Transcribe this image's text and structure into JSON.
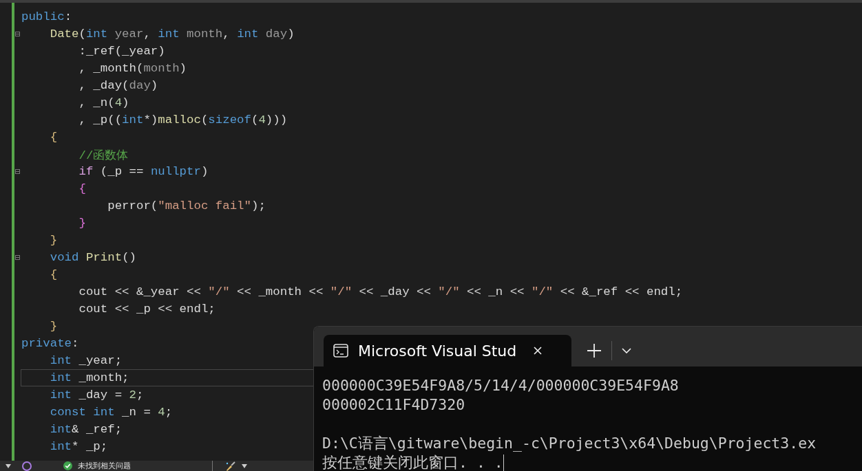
{
  "editor": {
    "lines": [
      {
        "fold": false,
        "current": false,
        "tokens": [
          {
            "kind": "kw",
            "text": "public"
          },
          {
            "kind": "plain",
            "text": ":"
          }
        ]
      },
      {
        "fold": true,
        "current": false,
        "tokens": [
          {
            "kind": "fn",
            "text": "    Date"
          },
          {
            "kind": "plain",
            "text": "("
          },
          {
            "kind": "kw",
            "text": "int"
          },
          {
            "kind": "param",
            "text": " year"
          },
          {
            "kind": "plain",
            "text": ", "
          },
          {
            "kind": "kw",
            "text": "int"
          },
          {
            "kind": "param",
            "text": " month"
          },
          {
            "kind": "plain",
            "text": ", "
          },
          {
            "kind": "kw",
            "text": "int"
          },
          {
            "kind": "param",
            "text": " day"
          },
          {
            "kind": "plain",
            "text": ")"
          }
        ]
      },
      {
        "fold": false,
        "current": false,
        "tokens": [
          {
            "kind": "plain",
            "text": "        :_ref(_year)"
          }
        ]
      },
      {
        "fold": false,
        "current": false,
        "tokens": [
          {
            "kind": "plain",
            "text": "        , _month("
          },
          {
            "kind": "param",
            "text": "month"
          },
          {
            "kind": "plain",
            "text": ")"
          }
        ]
      },
      {
        "fold": false,
        "current": false,
        "tokens": [
          {
            "kind": "plain",
            "text": "        , _day("
          },
          {
            "kind": "param",
            "text": "day"
          },
          {
            "kind": "plain",
            "text": ")"
          }
        ]
      },
      {
        "fold": false,
        "current": false,
        "tokens": [
          {
            "kind": "plain",
            "text": "        , _n("
          },
          {
            "kind": "num",
            "text": "4"
          },
          {
            "kind": "plain",
            "text": ")"
          }
        ]
      },
      {
        "fold": false,
        "current": false,
        "tokens": [
          {
            "kind": "plain",
            "text": "        , _p(("
          },
          {
            "kind": "kw",
            "text": "int"
          },
          {
            "kind": "plain",
            "text": "*)"
          },
          {
            "kind": "fn",
            "text": "malloc"
          },
          {
            "kind": "plain",
            "text": "("
          },
          {
            "kind": "kw",
            "text": "sizeof"
          },
          {
            "kind": "plain",
            "text": "("
          },
          {
            "kind": "num",
            "text": "4"
          },
          {
            "kind": "plain",
            "text": ")))"
          }
        ]
      },
      {
        "fold": false,
        "current": false,
        "tokens": [
          {
            "kind": "brace1",
            "text": "    {"
          }
        ]
      },
      {
        "fold": false,
        "current": false,
        "tokens": [
          {
            "kind": "comment",
            "text": "        //函数体"
          }
        ]
      },
      {
        "fold": true,
        "current": false,
        "tokens": [
          {
            "kind": "ctrl",
            "text": "        if"
          },
          {
            "kind": "plain",
            "text": " (_p == "
          },
          {
            "kind": "kw",
            "text": "nullptr"
          },
          {
            "kind": "plain",
            "text": ")"
          }
        ]
      },
      {
        "fold": false,
        "current": false,
        "tokens": [
          {
            "kind": "brace2",
            "text": "        {"
          }
        ]
      },
      {
        "fold": false,
        "current": false,
        "tokens": [
          {
            "kind": "plain",
            "text": "            perror("
          },
          {
            "kind": "str",
            "text": "\"malloc fail\""
          },
          {
            "kind": "plain",
            "text": ");"
          }
        ]
      },
      {
        "fold": false,
        "current": false,
        "tokens": [
          {
            "kind": "brace2",
            "text": "        }"
          }
        ]
      },
      {
        "fold": false,
        "current": false,
        "tokens": [
          {
            "kind": "brace1",
            "text": "    }"
          }
        ]
      },
      {
        "fold": true,
        "current": false,
        "tokens": [
          {
            "kind": "kw",
            "text": "    void"
          },
          {
            "kind": "fn",
            "text": " Print"
          },
          {
            "kind": "plain",
            "text": "()"
          }
        ]
      },
      {
        "fold": false,
        "current": false,
        "tokens": [
          {
            "kind": "brace1",
            "text": "    {"
          }
        ]
      },
      {
        "fold": false,
        "current": false,
        "tokens": [
          {
            "kind": "plain",
            "text": "        cout << &_year << "
          },
          {
            "kind": "str",
            "text": "\"/\""
          },
          {
            "kind": "plain",
            "text": " << _month << "
          },
          {
            "kind": "str",
            "text": "\"/\""
          },
          {
            "kind": "plain",
            "text": " << _day << "
          },
          {
            "kind": "str",
            "text": "\"/\""
          },
          {
            "kind": "plain",
            "text": " << _n << "
          },
          {
            "kind": "str",
            "text": "\"/\""
          },
          {
            "kind": "plain",
            "text": " << &_ref << endl;"
          }
        ]
      },
      {
        "fold": false,
        "current": false,
        "tokens": [
          {
            "kind": "plain",
            "text": "        cout << _p << endl;"
          }
        ]
      },
      {
        "fold": false,
        "current": false,
        "tokens": [
          {
            "kind": "brace1",
            "text": "    }"
          }
        ]
      },
      {
        "fold": false,
        "current": false,
        "tokens": [
          {
            "kind": "kw",
            "text": "private"
          },
          {
            "kind": "plain",
            "text": ":"
          }
        ]
      },
      {
        "fold": false,
        "current": false,
        "tokens": [
          {
            "kind": "kw",
            "text": "    int"
          },
          {
            "kind": "plain",
            "text": " _year;"
          }
        ]
      },
      {
        "fold": false,
        "current": true,
        "tokens": [
          {
            "kind": "kw",
            "text": "    int"
          },
          {
            "kind": "plain",
            "text": " _month;"
          }
        ]
      },
      {
        "fold": false,
        "current": false,
        "tokens": [
          {
            "kind": "kw",
            "text": "    int"
          },
          {
            "kind": "plain",
            "text": " _day = "
          },
          {
            "kind": "num",
            "text": "2"
          },
          {
            "kind": "plain",
            "text": ";"
          }
        ]
      },
      {
        "fold": false,
        "current": false,
        "tokens": [
          {
            "kind": "kw",
            "text": "    const int"
          },
          {
            "kind": "plain",
            "text": " _n = "
          },
          {
            "kind": "num",
            "text": "4"
          },
          {
            "kind": "plain",
            "text": ";"
          }
        ]
      },
      {
        "fold": false,
        "current": false,
        "tokens": [
          {
            "kind": "kw",
            "text": "    int"
          },
          {
            "kind": "plain",
            "text": "& _ref;"
          }
        ]
      },
      {
        "fold": false,
        "current": false,
        "tokens": [
          {
            "kind": "kw",
            "text": "    int"
          },
          {
            "kind": "plain",
            "text": "* _p;"
          }
        ]
      }
    ]
  },
  "status_bar": {
    "issues_text": "未找到相关问题"
  },
  "terminal": {
    "tab_title": "Microsoft Visual Stud",
    "output_blocks": [
      [
        "000000C39E54F9A8/5/14/4/000000C39E54F9A8",
        "000002C11F4D7320"
      ],
      [
        "D:\\C语言\\gitware\\begin_-c\\Project3\\x64\\Debug\\Project3.ex",
        "按任意键关闭此窗口. . ."
      ]
    ]
  }
}
